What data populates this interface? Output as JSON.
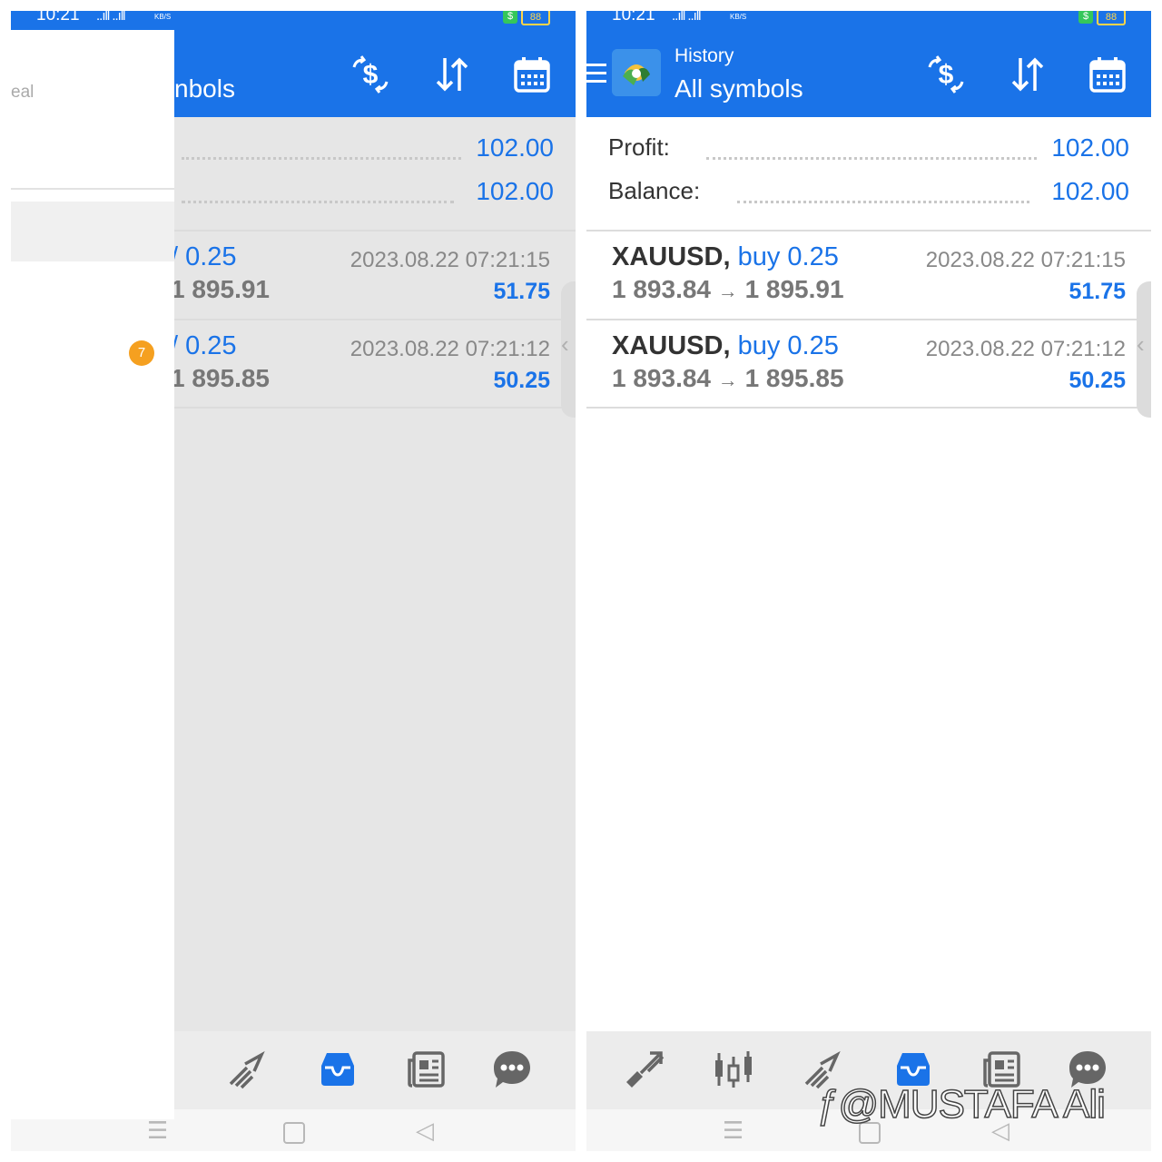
{
  "status": {
    "time": "10:21",
    "signal": "..ıll ..ıll",
    "speed_unit": "KB/S",
    "battery": "88"
  },
  "appbar": {
    "subtitle": "History",
    "title": "All symbols",
    "title_partial": "nbols"
  },
  "summary": {
    "profit_label": "Profit:",
    "profit_value": "102.00",
    "balance_label": "Balance:",
    "balance_value": "102.00"
  },
  "deals": [
    {
      "symbol": "XAUUSD,",
      "direction": "buy 0.25",
      "direction_partial": "/ 0.25",
      "open_price": "1 893.84",
      "close_price": "1 895.91",
      "close_partial": "1 895.91",
      "time": "2023.08.22 07:21:15",
      "profit": "51.75"
    },
    {
      "symbol": "XAUUSD,",
      "direction": "buy 0.25",
      "direction_partial": "/ 0.25",
      "open_price": "1 893.84",
      "close_price": "1 895.85",
      "close_partial": "1 895.85",
      "time": "2023.08.22 07:21:12",
      "profit": "50.25"
    }
  ],
  "drawer": {
    "peek_text": "eal",
    "badge": "7"
  },
  "icons": {
    "toolbar": [
      "deposit-currency-icon",
      "sort-icon",
      "calendar-icon"
    ],
    "bottom_nav": [
      "quotes-icon",
      "chart-icon",
      "trade-icon",
      "history-icon",
      "news-icon",
      "chat-icon"
    ],
    "system_nav": [
      "menu-key-icon",
      "home-key-icon",
      "back-key-icon"
    ]
  },
  "colors": {
    "primary": "#1a73e8",
    "badge": "#f5a020"
  },
  "watermark": "@MUSTAFA Ali"
}
